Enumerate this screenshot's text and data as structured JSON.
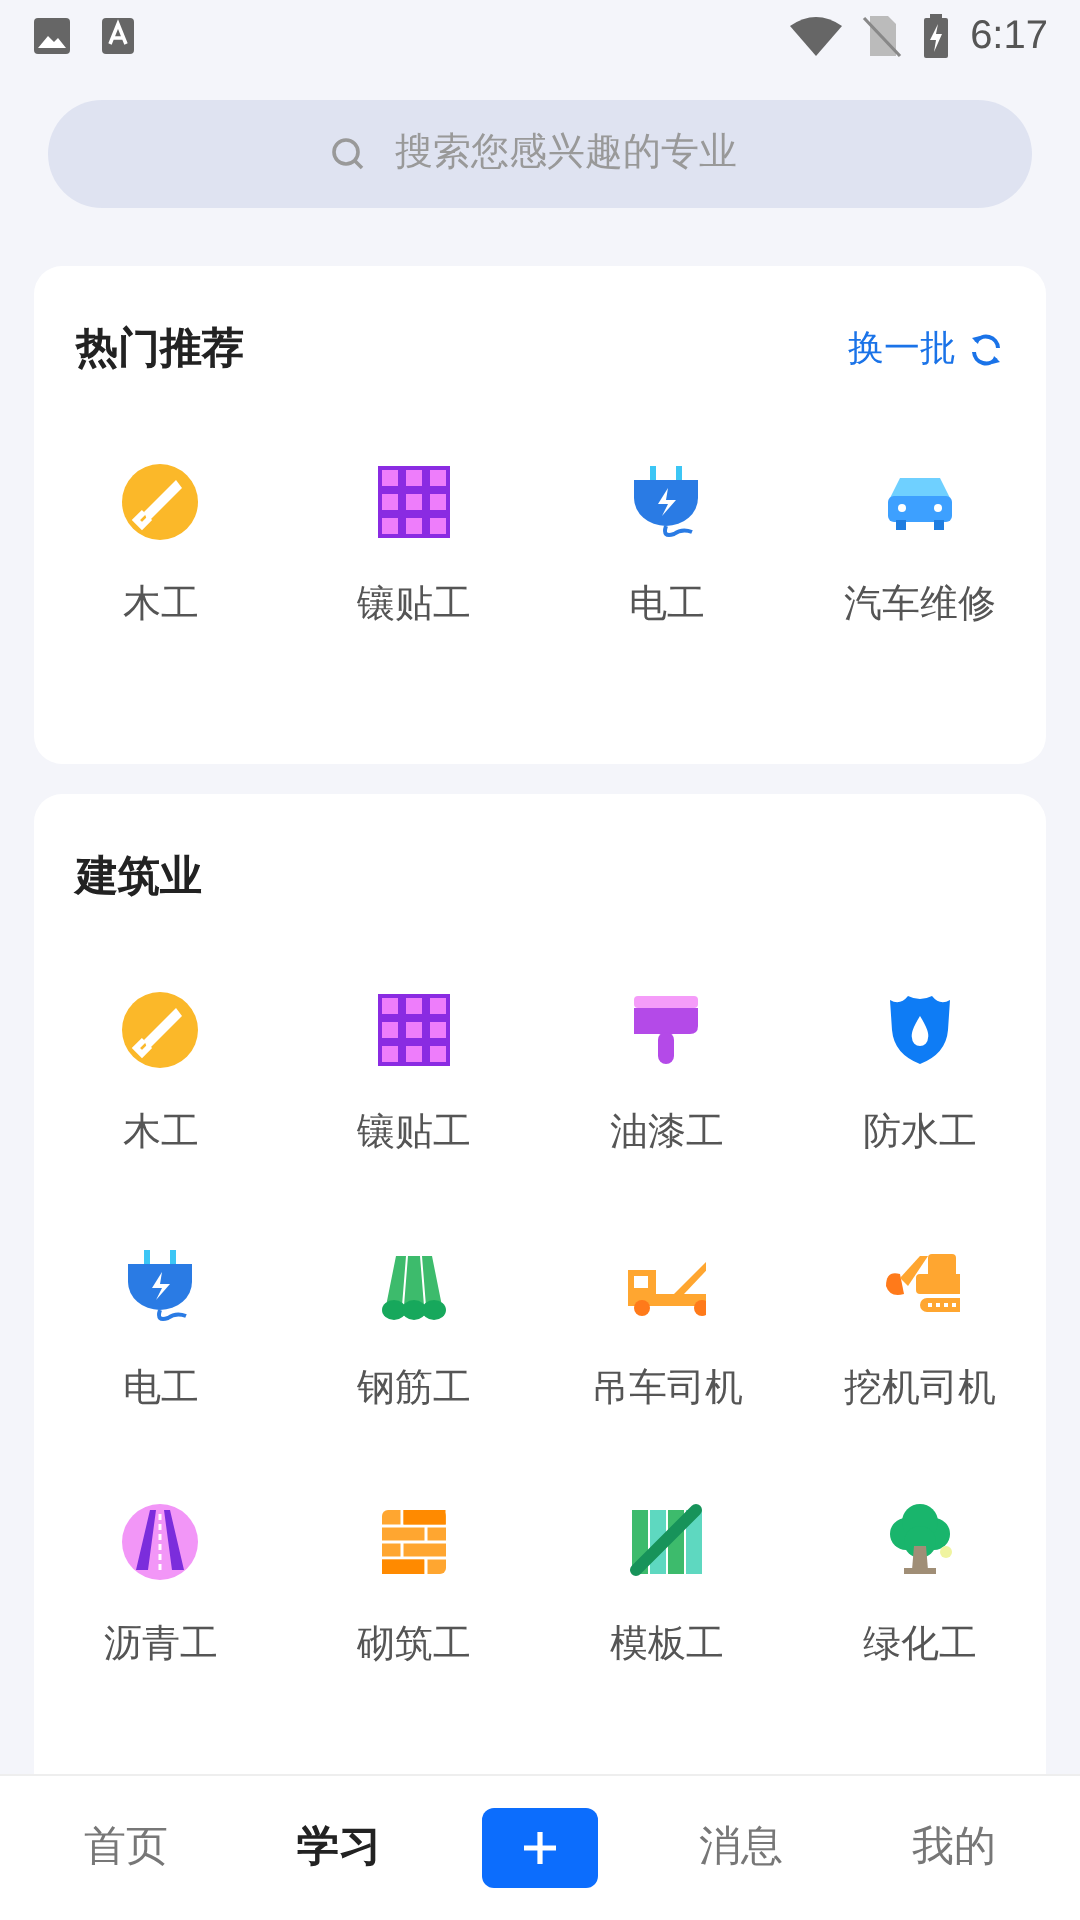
{
  "status_bar": {
    "time": "6:17"
  },
  "search": {
    "placeholder": "搜索您感兴趣的专业"
  },
  "hot": {
    "title": "热门推荐",
    "refresh": "换一批",
    "items": [
      {
        "label": "木工",
        "kind": "saw"
      },
      {
        "label": "镶贴工",
        "kind": "tiles"
      },
      {
        "label": "电工",
        "kind": "plug"
      },
      {
        "label": "汽车维修",
        "kind": "car"
      }
    ]
  },
  "construction": {
    "title": "建筑业",
    "items": [
      {
        "label": "木工",
        "kind": "saw"
      },
      {
        "label": "镶贴工",
        "kind": "tiles"
      },
      {
        "label": "油漆工",
        "kind": "brush"
      },
      {
        "label": "防水工",
        "kind": "shield"
      },
      {
        "label": "电工",
        "kind": "plug"
      },
      {
        "label": "钢筋工",
        "kind": "rebar"
      },
      {
        "label": "吊车司机",
        "kind": "crane"
      },
      {
        "label": "挖机司机",
        "kind": "excavator"
      },
      {
        "label": "沥青工",
        "kind": "road"
      },
      {
        "label": "砌筑工",
        "kind": "bricks"
      },
      {
        "label": "模板工",
        "kind": "formwork"
      },
      {
        "label": "绿化工",
        "kind": "tree"
      }
    ]
  },
  "nav": [
    {
      "label": "首页",
      "kind": "tab",
      "selected": false
    },
    {
      "label": "学习",
      "kind": "tab",
      "selected": true
    },
    {
      "kind": "add"
    },
    {
      "label": "消息",
      "kind": "tab",
      "selected": false
    },
    {
      "label": "我的",
      "kind": "tab",
      "selected": false
    }
  ]
}
